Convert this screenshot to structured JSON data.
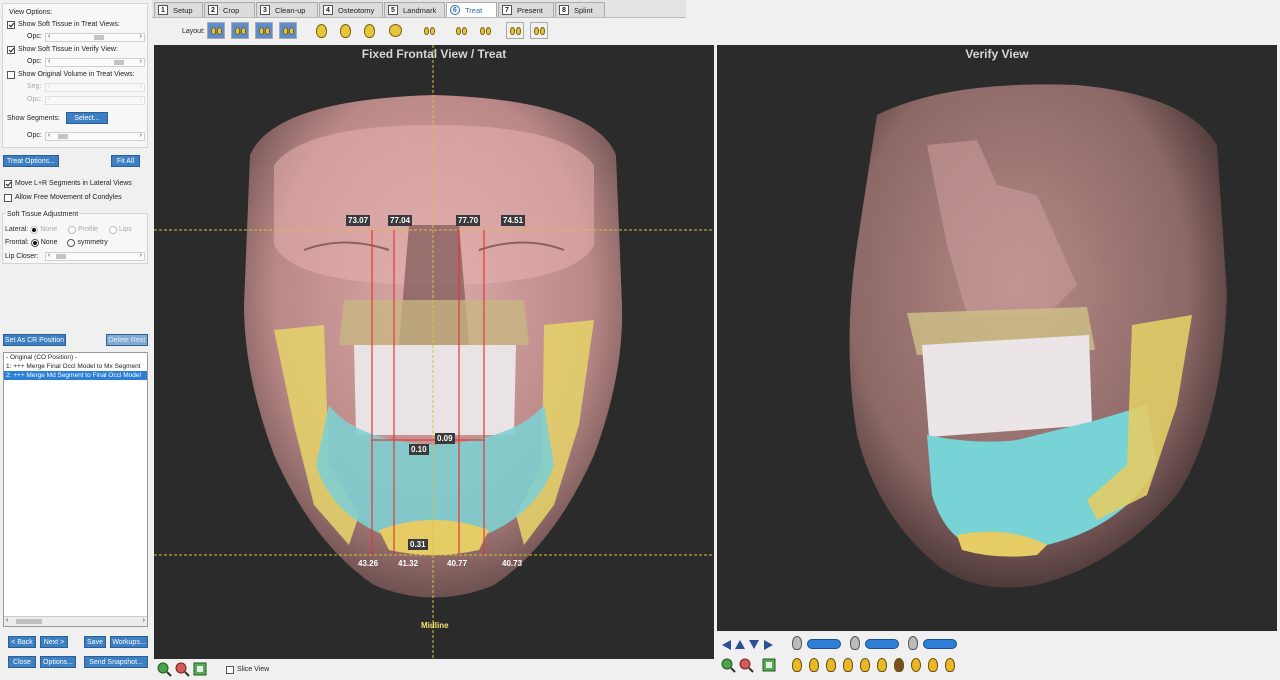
{
  "left_panel": {
    "view_options": {
      "title": "View Options:",
      "show_soft_tissue_treat": "Show Soft Tissue in Treat Views:",
      "show_soft_tissue_verify": "Show Soft Tissue in Verify View:",
      "show_original_volume": "Show Original Volume in Treat Views:",
      "opc_label": "Opc:",
      "seg_label": "Seg:",
      "show_segments": "Show Segments:",
      "select_button": "Select..."
    },
    "treat_options_button": "Treat Options...",
    "fit_all_button": "Fit All",
    "move_lr_segments": "Move L+R Segments in Lateral Views",
    "allow_free_movement": "Allow Free Movement of Condyles",
    "soft_tissue_adjustment": {
      "title": "Soft Tissue Adjustment",
      "lateral_label": "Lateral:",
      "none": "None",
      "profile": "Profile",
      "lips": "Lips",
      "frontal_label": "Frontal:",
      "symmetry": "symmetry",
      "lip_closer_label": "Lip Closer:"
    },
    "set_as_cr_button": "Set As CR Position",
    "delete_rest_button": "Delete Rest",
    "history": [
      "- Original (CO Position) -",
      "1: +++ Merge Final Occl Model to Mx Segment",
      "2: +++ Merge Md Segment to Final Occl Model"
    ],
    "buttons": {
      "back": "< Back",
      "next": "Next >",
      "save": "Save",
      "workups": "Workups...",
      "close": "Close",
      "options": "Options...",
      "send_snapshot": "Send Snapshot..."
    }
  },
  "tabs": [
    {
      "num": "1",
      "label": "Setup"
    },
    {
      "num": "2",
      "label": "Crop"
    },
    {
      "num": "3",
      "label": "Clean-up"
    },
    {
      "num": "4",
      "label": "Osteotomy"
    },
    {
      "num": "5",
      "label": "Landmark"
    },
    {
      "num": "6",
      "label": "Treat"
    },
    {
      "num": "7",
      "label": "Present"
    },
    {
      "num": "8",
      "label": "Splint"
    }
  ],
  "layout_label": "Layout:",
  "viewport_left": {
    "title": "Fixed Frontal View / Treat",
    "upper_measurements": [
      "73.07",
      "77.04",
      "77.70",
      "74.51"
    ],
    "center_measurements": [
      "0.09",
      "0.10"
    ],
    "chin_measurement": "0.31",
    "lower_measurements": [
      "43.26",
      "41.32",
      "40.77",
      "40.73"
    ],
    "midline_label": "Midline",
    "slice_view_label": "Slice View"
  },
  "viewport_right": {
    "title": "Verify View"
  },
  "colors": {
    "accent_blue": "#3c7fc2",
    "viewport_bg": "#2b2b2b",
    "measure_line": "#e03a3a",
    "guide_line": "#d8c23a"
  }
}
